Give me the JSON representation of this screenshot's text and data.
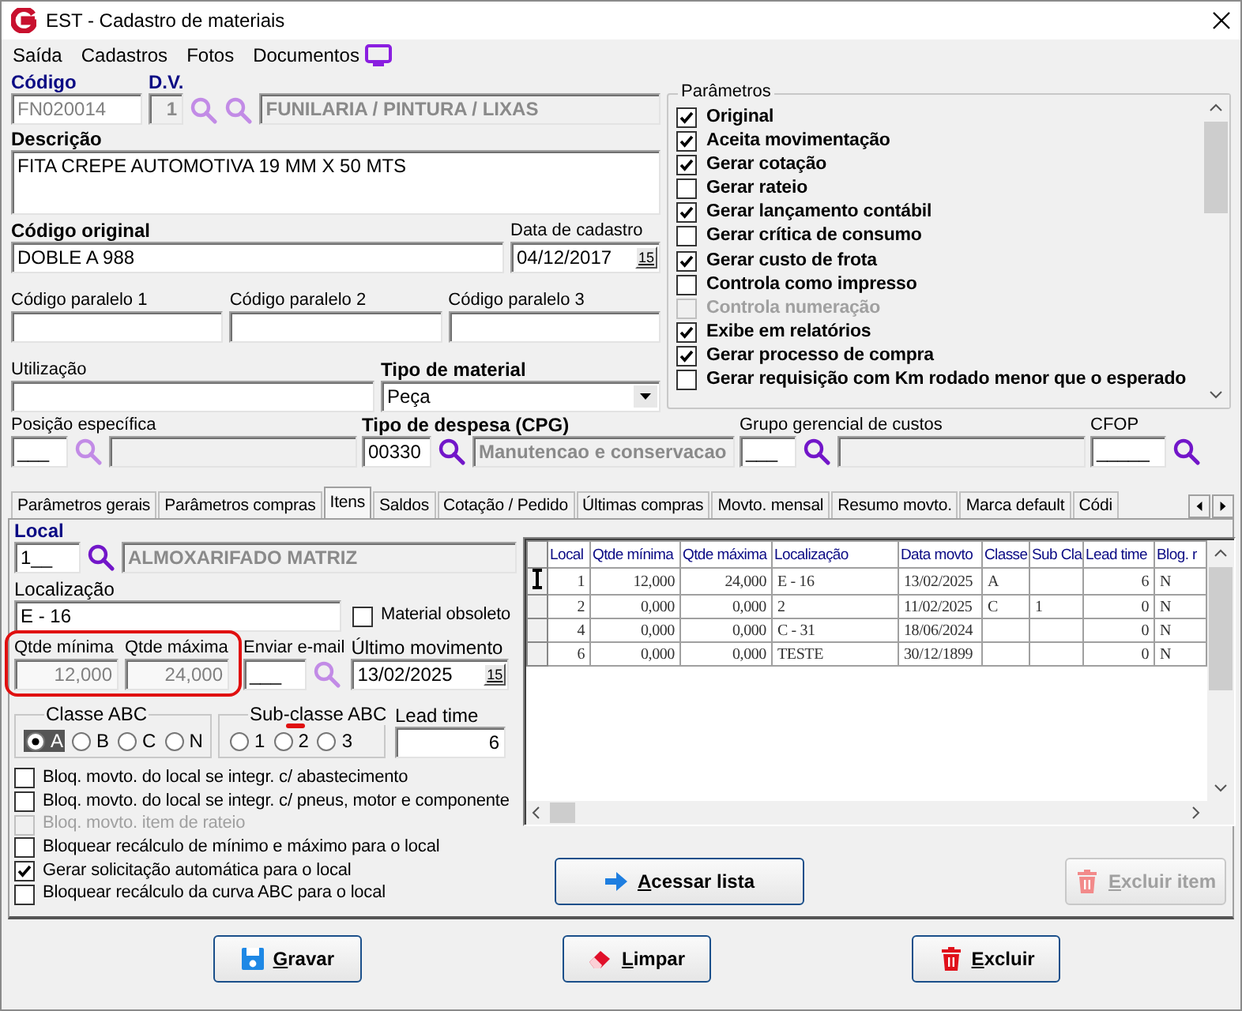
{
  "window": {
    "title": "EST - Cadastro de materiais"
  },
  "menu": [
    {
      "label": "Saída"
    },
    {
      "label": "Cadastros"
    },
    {
      "label": "Fotos"
    },
    {
      "label": "Documentos"
    }
  ],
  "codigo": {
    "label": "Código",
    "value": "FN020014",
    "disabled": true
  },
  "dv": {
    "label": "D.V.",
    "value": "1",
    "disabled": true
  },
  "grupo": {
    "value": "FUNILARIA / PINTURA / LIXAS"
  },
  "descricao": {
    "label": "Descrição",
    "value": "FITA CREPE AUTOMOTIVA 19 MM X 50 MTS"
  },
  "codigo_original": {
    "label": "Código original",
    "value": "DOBLE A 988"
  },
  "data_cadastro": {
    "label": "Data de cadastro",
    "value": "04/12/2017",
    "calendar": "15"
  },
  "codigos_paralelos": [
    {
      "label": "Código paralelo 1"
    },
    {
      "label": "Código paralelo 2"
    },
    {
      "label": "Código paralelo 3"
    }
  ],
  "utilizacao": {
    "label": "Utilização"
  },
  "tipo_material": {
    "label": "Tipo de material",
    "value": "Peça"
  },
  "lookups": [
    {
      "kind": "with_description",
      "label": "Posição específica",
      "required": false,
      "code": "___",
      "search_enabled": false
    },
    {
      "kind": "with_description",
      "label": "Tipo de despesa (CPG)",
      "required": true,
      "code": "00330",
      "search_enabled": true,
      "description": "Manutencao e conservacao"
    },
    {
      "kind": "with_description",
      "label": "Grupo gerencial de custos",
      "required": false,
      "code": "___",
      "search_enabled": true
    },
    {
      "kind": "code_only",
      "label": "CFOP",
      "required": false,
      "code": "_____",
      "search_enabled": true
    }
  ],
  "parametros": {
    "title": "Parâmetros",
    "items": [
      {
        "label": "Original",
        "checked": true,
        "disabled": false
      },
      {
        "label": "Aceita movimentação",
        "checked": true,
        "disabled": false
      },
      {
        "label": "Gerar cotação",
        "checked": true,
        "disabled": false
      },
      {
        "label": "Gerar rateio",
        "checked": false,
        "disabled": false
      },
      {
        "label": "Gerar lançamento contábil",
        "checked": true,
        "disabled": false
      },
      {
        "label": "Gerar crítica de consumo",
        "checked": false,
        "disabled": false
      },
      {
        "label": "Gerar custo de frota",
        "checked": true,
        "disabled": false
      },
      {
        "label": "Controla como impresso",
        "checked": false,
        "disabled": false
      },
      {
        "label": "Controla numeração",
        "checked": false,
        "disabled": true
      },
      {
        "label": "Exibe em relatórios",
        "checked": true,
        "disabled": false
      },
      {
        "label": "Gerar processo de compra",
        "checked": true,
        "disabled": false
      },
      {
        "label": "Gerar requisição com Km rodado menor que o esperado",
        "checked": false,
        "disabled": false
      }
    ]
  },
  "tabs": [
    {
      "label": "Parâmetros gerais",
      "selected": false
    },
    {
      "label": "Parâmetros compras",
      "selected": false
    },
    {
      "label": "Itens",
      "selected": true
    },
    {
      "label": "Saldos",
      "selected": false
    },
    {
      "label": "Cotação / Pedido",
      "selected": false
    },
    {
      "label": "Últimas compras",
      "selected": false
    },
    {
      "label": "Movto. mensal",
      "selected": false
    },
    {
      "label": "Resumo movto.",
      "selected": false
    },
    {
      "label": "Marca default",
      "selected": false
    },
    {
      "label": "Códi",
      "selected": false
    }
  ],
  "itens": {
    "local": {
      "label": "Local",
      "code": "1__",
      "name": "ALMOXARIFADO MATRIZ"
    },
    "localizacao": {
      "label": "Localização",
      "value": "E - 16"
    },
    "obsoleto": {
      "label": "Material obsoleto",
      "checked": false
    },
    "quantidades": {
      "highlighted": true,
      "fields": [
        {
          "label": "Qtde mínima",
          "value": "12,000",
          "disabled": true
        },
        {
          "label": "Qtde máxima",
          "value": "24,000",
          "disabled": true
        }
      ]
    },
    "enviar_email": {
      "label": "Enviar e-mail",
      "value": "___"
    },
    "ultimo_movimento": {
      "label": "Último movimento",
      "value": "13/02/2025",
      "calendar": "15"
    },
    "classe_abc": {
      "label": "Classe ABC",
      "options": [
        {
          "label": "A",
          "selected": true,
          "marked": false
        },
        {
          "label": "B",
          "selected": false,
          "marked": false
        },
        {
          "label": "C",
          "selected": false,
          "marked": false
        },
        {
          "label": "N",
          "selected": false,
          "marked": false
        }
      ]
    },
    "subclasse_abc": {
      "label": "Sub-classe ABC",
      "options": [
        {
          "label": "1",
          "selected": false,
          "marked": false
        },
        {
          "label": "2",
          "selected": false,
          "marked": true
        },
        {
          "label": "3",
          "selected": false,
          "marked": false
        }
      ]
    },
    "lead_time": {
      "label": "Lead time",
      "value": "6"
    },
    "flags": [
      {
        "label": "Bloq. movto. do local se integr. c/ abastecimento",
        "checked": false,
        "disabled": false
      },
      {
        "label": "Bloq. movto. do local se integr. c/ pneus, motor e componente",
        "checked": false,
        "disabled": false
      },
      {
        "label": "Bloq. movto. item de rateio",
        "checked": false,
        "disabled": true
      },
      {
        "label": "Bloquear recálculo de mínimo e máximo para o local",
        "checked": false,
        "disabled": false
      },
      {
        "label": "Gerar solicitação automática para o local",
        "checked": true,
        "disabled": false
      },
      {
        "label": "Bloquear recálculo da curva ABC para o local",
        "checked": false,
        "disabled": false
      }
    ],
    "grid": {
      "columns": [
        "Local",
        "Qtde mínima",
        "Qtde máxima",
        "Localização",
        "Data movto",
        "Classe",
        "Sub Cla",
        "Lead time",
        "Blog. r"
      ],
      "rows": [
        {
          "current": true,
          "cells": [
            "1",
            "12,000",
            "24,000",
            "E - 16",
            "13/02/2025",
            "A",
            "",
            "6",
            "N"
          ]
        },
        {
          "current": false,
          "cells": [
            "2",
            "0,000",
            "0,000",
            "2",
            "11/02/2025",
            "C",
            "1",
            "0",
            "N"
          ]
        },
        {
          "current": false,
          "cells": [
            "4",
            "0,000",
            "0,000",
            "C - 31",
            "18/06/2024",
            "",
            "",
            "0",
            "N"
          ]
        },
        {
          "current": false,
          "cells": [
            "6",
            "0,000",
            "0,000",
            "TESTE",
            "30/12/1899",
            "",
            "",
            "0",
            "N"
          ]
        }
      ]
    },
    "acessar": {
      "label": "Acessar lista",
      "disabled": false
    },
    "excluir_item": {
      "label": "Excluir item",
      "disabled": true
    }
  },
  "buttons": [
    {
      "kind": "save",
      "label": "Gravar"
    },
    {
      "kind": "clear",
      "label": "Limpar"
    },
    {
      "kind": "delete",
      "label": "Excluir"
    }
  ]
}
